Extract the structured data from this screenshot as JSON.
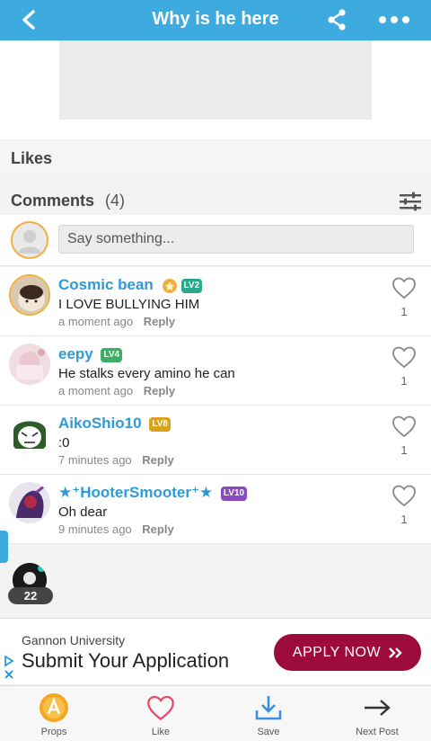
{
  "topbar": {
    "title": "Why is he here"
  },
  "likes": {
    "label": "Likes"
  },
  "comments": {
    "label": "Comments",
    "count": "(4)",
    "input_placeholder": "Say something...",
    "items": [
      {
        "name": "Cosmic bean",
        "level": "LV2",
        "text": "I LOVE BULLYING HIM",
        "time": "a moment ago",
        "reply": "Reply",
        "likes": "1"
      },
      {
        "name": "eepy",
        "level": "LV4",
        "text": "He stalks every amino he can",
        "time": "a moment ago",
        "reply": "Reply",
        "likes": "1"
      },
      {
        "name": "AikoShio10",
        "level": "LV8",
        "text": ":0",
        "time": "7 minutes ago",
        "reply": "Reply",
        "likes": "1"
      },
      {
        "name": "★⁺HooterSmooter⁺★",
        "level": "LV10",
        "text": "Oh dear",
        "time": "9 minutes ago",
        "reply": "Reply",
        "likes": "1"
      }
    ]
  },
  "floating": {
    "online_count": "22"
  },
  "ad": {
    "sponsor": "Gannon University",
    "headline": "Submit Your Application",
    "cta": "APPLY NOW"
  },
  "bottom_nav": {
    "props": "Props",
    "like": "Like",
    "save": "Save",
    "next": "Next Post"
  },
  "colors": {
    "accent": "#3daae0",
    "username": "#2e9ad8",
    "cta": "#9c0b3a",
    "gold": "#f0b040"
  }
}
